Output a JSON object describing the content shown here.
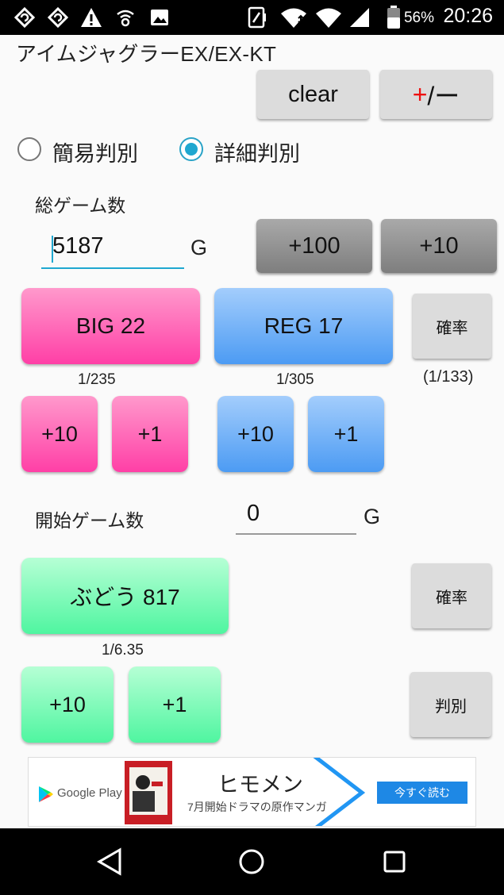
{
  "status_bar": {
    "battery_percent": "56%",
    "time": "20:26",
    "icons": [
      "sync-icon",
      "sync-icon",
      "warning-icon",
      "wifi-calling-icon",
      "image-icon",
      "nfc-icon",
      "wifi-icon",
      "signal-icon",
      "battery-icon"
    ]
  },
  "app": {
    "title": "アイムジャグラーEX/EX-KT",
    "clear_label": "clear",
    "plus_minus": {
      "plus": "+",
      "rest": "/ー"
    },
    "modes": {
      "simple": "簡易判別",
      "detail": "詳細判別",
      "selected": "detail"
    },
    "total_games": {
      "label": "総ゲーム数",
      "value": "5187",
      "unit": "G",
      "add100": "+100",
      "add10": "+10"
    },
    "big": {
      "label": "BIG 22",
      "prob": "1/235",
      "add10": "+10",
      "add1": "+1"
    },
    "reg": {
      "label": "REG 17",
      "prob": "1/305",
      "add10": "+10",
      "add1": "+1"
    },
    "prob_button": "確率",
    "combined_prob": "(1/133)",
    "start_games": {
      "label": "開始ゲーム数",
      "value": "0",
      "unit": "G"
    },
    "grape": {
      "label": "ぶどう 817",
      "prob": "1/6.35",
      "add10": "+10",
      "add1": "+1"
    },
    "grape_prob_button": "確率",
    "judge_button": "判別"
  },
  "ad": {
    "store": "Google Play",
    "title": "ヒモメン",
    "subtitle": "7月開始ドラマの原作マンガ",
    "cta": "今すぐ読む"
  },
  "colors": {
    "accent": "#1fa7d0",
    "pink": "#ff3fa6",
    "blue": "#4c9bf3",
    "green": "#4ff5a0",
    "ad_cta": "#1e88e5"
  }
}
